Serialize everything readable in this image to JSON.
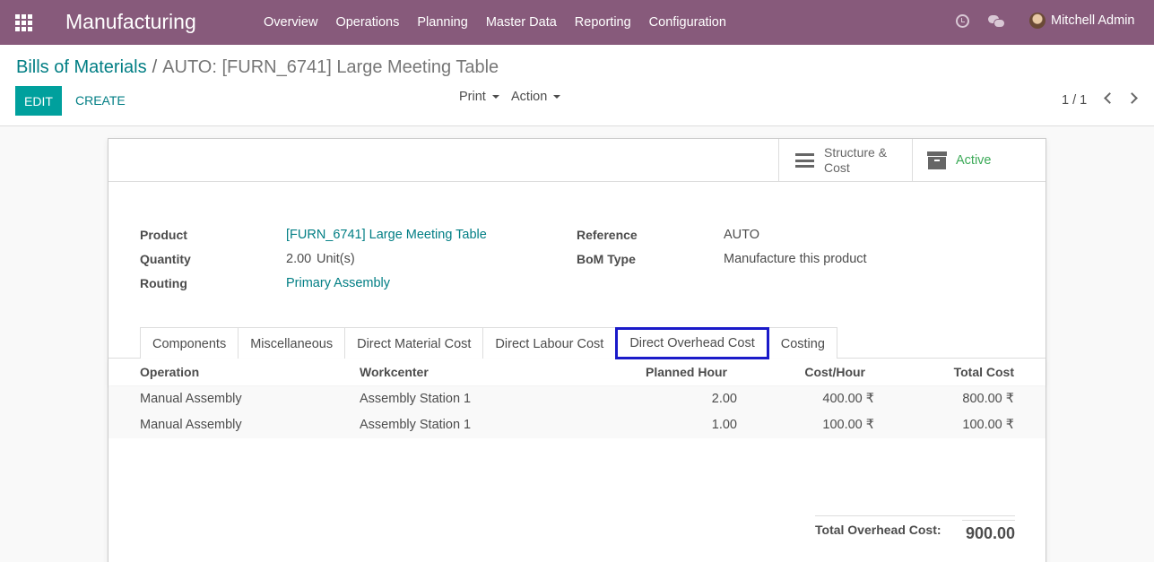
{
  "navbar": {
    "brand": "Manufacturing",
    "menu": [
      "Overview",
      "Operations",
      "Planning",
      "Master Data",
      "Reporting",
      "Configuration"
    ],
    "user": "Mitchell Admin",
    "color": "#875a7b"
  },
  "control_panel": {
    "breadcrumb_parent": "Bills of Materials",
    "breadcrumb_separator": "/",
    "breadcrumb_current": "AUTO: [FURN_6741] Large Meeting Table",
    "edit_label": "EDIT",
    "create_label": "CREATE",
    "print_label": "Print",
    "action_label": "Action",
    "pager": "1 / 1"
  },
  "form": {
    "smart_buttons": {
      "structure_line1": "Structure &",
      "structure_line2": "Cost",
      "active": "Active"
    },
    "fields": {
      "product_label": "Product",
      "product_value": "[FURN_6741] Large Meeting Table",
      "quantity_label": "Quantity",
      "quantity_value": "2.00",
      "quantity_uom": "Unit(s)",
      "routing_label": "Routing",
      "routing_value": "Primary Assembly",
      "reference_label": "Reference",
      "reference_value": "AUTO",
      "bom_type_label": "BoM Type",
      "bom_type_value": "Manufacture this product"
    },
    "tabs": [
      "Components",
      "Miscellaneous",
      "Direct Material Cost",
      "Direct Labour Cost",
      "Direct Overhead Cost",
      "Costing"
    ],
    "selected_tab": "Direct Overhead Cost",
    "table": {
      "headers": [
        "Operation",
        "Workcenter",
        "Planned Hour",
        "Cost/Hour",
        "Total Cost"
      ],
      "rows": [
        [
          "Manual Assembly",
          "Assembly Station 1",
          "2.00",
          "400.00 ₹",
          "800.00 ₹"
        ],
        [
          "Manual Assembly",
          "Assembly Station 1",
          "1.00",
          "100.00 ₹",
          "100.00 ₹"
        ]
      ]
    },
    "total_label": "Total Overhead Cost:",
    "total_value": "900.00"
  }
}
